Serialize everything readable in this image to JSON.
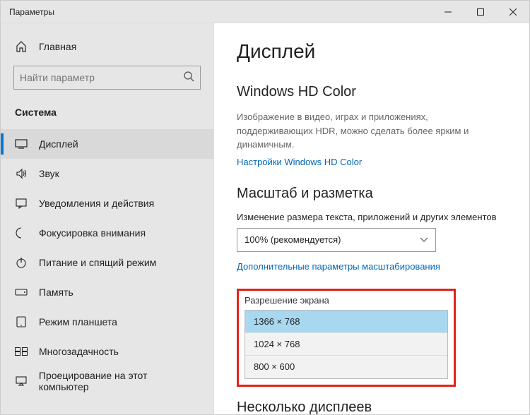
{
  "window": {
    "title": "Параметры"
  },
  "sidebar": {
    "home": "Главная",
    "search_placeholder": "Найти параметр",
    "section": "Система",
    "items": [
      "Дисплей",
      "Звук",
      "Уведомления и действия",
      "Фокусировка внимания",
      "Питание и спящий режим",
      "Память",
      "Режим планшета",
      "Многозадачность",
      "Проецирование на этот компьютер"
    ]
  },
  "main": {
    "title": "Дисплей",
    "hd": {
      "heading": "Windows HD Color",
      "desc": "Изображение в видео, играх и приложениях, поддерживающих HDR, можно сделать более ярким и динамичным.",
      "link": "Настройки Windows HD Color"
    },
    "scale": {
      "heading": "Масштаб и разметка",
      "label": "Изменение размера текста, приложений и других элементов",
      "value": "100% (рекомендуется)",
      "link": "Дополнительные параметры масштабирования"
    },
    "res": {
      "label": "Разрешение экрана",
      "options": [
        "1366 × 768",
        "1024 × 768",
        "800 × 600"
      ]
    },
    "multi": {
      "heading": "Несколько дисплеев"
    }
  }
}
